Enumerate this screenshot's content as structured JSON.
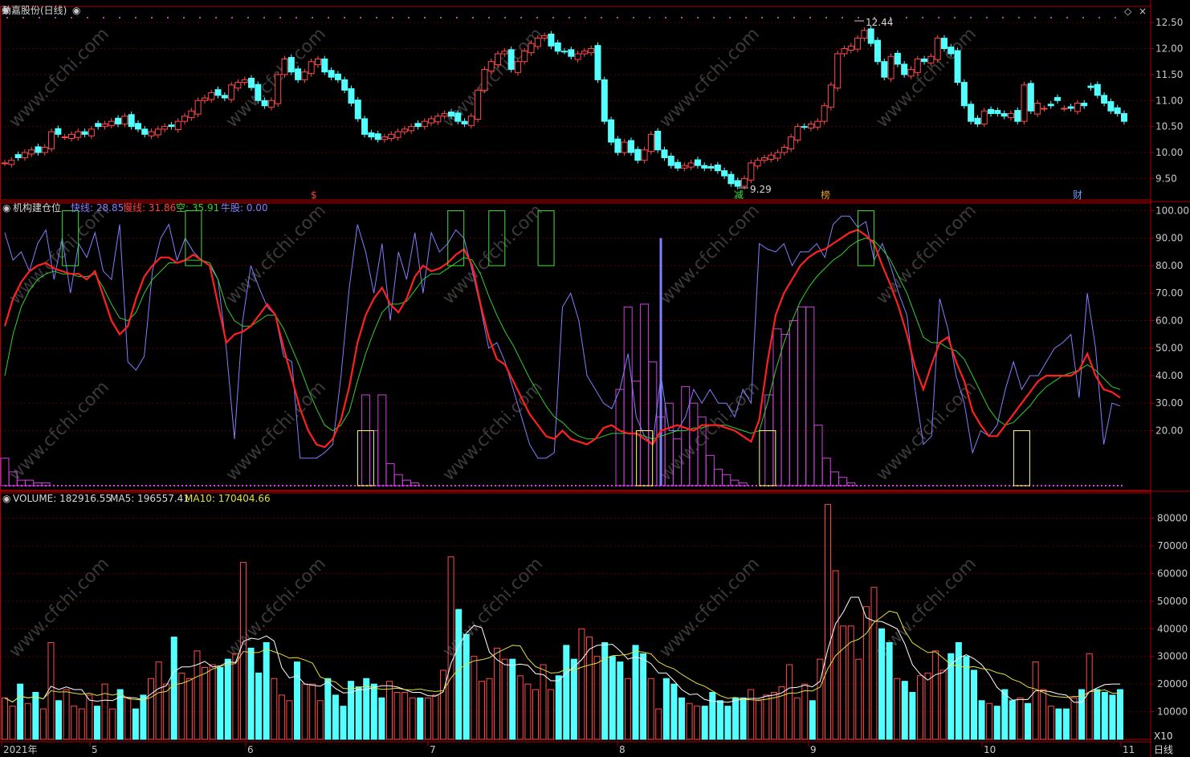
{
  "header": {
    "title": "劲嘉股份(日线)",
    "indicator_name": "机构建仓位",
    "fast_label": "快线: 28.85",
    "slow_label": "慢线: 31.86",
    "empty_label": "空: 35.91",
    "bull_label": "牛股: 0.00",
    "volume_label": "VOLUME: 182916.55",
    "ma5_label": "MA5: 196557.41",
    "ma10_label": "MA10: 170404.66",
    "x10_label": "X10",
    "period_label": "日线",
    "watermark": "www.cfchi.com"
  },
  "colors": {
    "up": "#ff4a4a",
    "down": "#54ffff",
    "axis": "#b00000",
    "grid": "#5a0000",
    "fast": "#8080ff",
    "slow": "#ff2020",
    "mid": "#30d030",
    "bar": "#d040e0",
    "box_green": "#40e040",
    "box_yellow": "#ffff60",
    "text": "#c8c8c8",
    "ma10": "#e0e040"
  },
  "markers": [
    {
      "text": "$",
      "color": "#ff4040"
    },
    {
      "text": "减",
      "color": "#40e040"
    },
    {
      "text": "榜",
      "color": "#e0a020"
    },
    {
      "text": "财",
      "color": "#60a0ff"
    }
  ],
  "chart_data": [
    {
      "type": "candlestick",
      "title": "劲嘉股份(日线)",
      "y_ticks": [
        9.5,
        10.0,
        10.5,
        11.0,
        11.5,
        12.0,
        12.5
      ],
      "ylim": [
        9.15,
        12.75
      ],
      "annotations": [
        {
          "text": "12.44",
          "value": 12.44
        },
        {
          "text": "9.29",
          "value": 9.29
        }
      ],
      "x_ticks": [
        "2021年",
        "5",
        "6",
        "7",
        "8",
        "9",
        "10",
        "11"
      ],
      "close": [
        9.8,
        9.85,
        9.9,
        10.0,
        10.05,
        10.0,
        10.1,
        10.4,
        10.35,
        10.3,
        10.35,
        10.4,
        10.35,
        10.45,
        10.5,
        10.55,
        10.6,
        10.55,
        10.7,
        10.5,
        10.45,
        10.35,
        10.4,
        10.45,
        10.5,
        10.5,
        10.6,
        10.7,
        10.8,
        11.0,
        11.05,
        11.15,
        11.1,
        11.05,
        11.3,
        11.35,
        11.4,
        11.25,
        11.0,
        10.9,
        11.0,
        11.5,
        11.8,
        11.55,
        11.4,
        11.55,
        11.75,
        11.8,
        11.55,
        11.45,
        11.4,
        11.2,
        10.95,
        10.65,
        10.35,
        10.3,
        10.25,
        10.3,
        10.35,
        10.4,
        10.45,
        10.5,
        10.5,
        10.6,
        10.65,
        10.7,
        10.75,
        10.7,
        10.6,
        10.55,
        10.7,
        11.2,
        11.6,
        11.75,
        11.9,
        11.95,
        11.6,
        11.75,
        11.95,
        12.1,
        12.2,
        12.25,
        12.05,
        11.95,
        11.95,
        11.85,
        11.9,
        11.95,
        12.0,
        11.4,
        10.6,
        10.2,
        10.0,
        10.2,
        10.0,
        9.85,
        10.05,
        10.35,
        10.05,
        9.9,
        9.75,
        9.7,
        9.75,
        9.8,
        9.75,
        9.7,
        9.7,
        9.65,
        9.55,
        9.4,
        9.35,
        9.5,
        9.8,
        9.85,
        9.9,
        9.95,
        10.0,
        10.1,
        10.3,
        10.5,
        10.5,
        10.55,
        10.6,
        10.9,
        11.3,
        11.9,
        12.0,
        12.05,
        12.2,
        12.35,
        12.1,
        11.75,
        11.45,
        11.85,
        11.7,
        11.5,
        11.6,
        11.8,
        11.75,
        11.85,
        12.2,
        12.0,
        11.9,
        11.35,
        10.9,
        10.6,
        10.55,
        10.8,
        10.75,
        10.75,
        10.7,
        10.75,
        10.6,
        11.3,
        10.8,
        10.95,
        10.85,
        10.9,
        11.0,
        10.85,
        10.85,
        10.95,
        10.9,
        11.25,
        11.1,
        10.95,
        10.8,
        10.75,
        10.6
      ],
      "up": [
        true,
        true,
        false,
        true,
        true,
        false,
        true,
        true,
        false,
        true,
        true,
        true,
        false,
        true,
        false,
        true,
        true,
        false,
        true,
        false,
        false,
        false,
        true,
        true,
        true,
        false,
        true,
        true,
        true,
        true,
        true,
        true,
        false,
        false,
        true,
        true,
        true,
        false,
        false,
        false,
        true,
        true,
        true,
        false,
        false,
        true,
        true,
        true,
        false,
        false,
        false,
        false,
        false,
        false,
        false,
        false,
        false,
        true,
        true,
        true,
        true,
        true,
        false,
        true,
        true,
        true,
        true,
        false,
        false,
        false,
        true,
        true,
        true,
        true,
        true,
        true,
        false,
        true,
        true,
        true,
        true,
        true,
        false,
        false,
        false,
        false,
        true,
        true,
        true,
        false,
        false,
        false,
        false,
        true,
        false,
        false,
        true,
        true,
        false,
        false,
        false,
        false,
        true,
        true,
        false,
        false,
        false,
        false,
        false,
        false,
        false,
        true,
        true,
        true,
        true,
        true,
        true,
        true,
        true,
        true,
        false,
        true,
        true,
        true,
        true,
        true,
        true,
        true,
        true,
        true,
        false,
        false,
        false,
        true,
        false,
        false,
        true,
        true,
        false,
        true,
        true,
        false,
        false,
        false,
        false,
        false,
        false,
        true,
        false,
        false,
        false,
        true,
        false,
        true,
        false,
        true,
        true,
        false,
        false,
        true,
        false,
        true,
        false,
        false,
        false,
        false,
        false
      ]
    },
    {
      "type": "line",
      "title": "机构建仓位",
      "y_ticks": [
        20,
        30,
        40,
        50,
        60,
        70,
        80,
        90,
        100
      ],
      "ylim": [
        0,
        101
      ],
      "series": [
        {
          "name": "快线",
          "values": [
            92,
            82,
            85,
            78,
            88,
            93,
            75,
            90,
            70,
            88,
            83,
            92,
            78,
            75,
            95,
            45,
            42,
            47,
            78,
            90,
            95,
            82,
            90,
            85,
            82,
            80,
            75,
            50,
            17,
            60,
            80,
            72,
            65,
            62,
            47,
            45,
            10,
            10,
            10,
            12,
            15,
            40,
            72,
            95,
            85,
            70,
            88,
            60,
            85,
            75,
            92,
            70,
            92,
            85,
            88,
            93,
            90,
            78,
            65,
            50,
            52,
            45,
            35,
            25,
            15,
            10,
            10,
            12,
            65,
            70,
            60,
            40,
            35,
            30,
            28,
            35,
            48,
            25,
            18,
            15,
            40,
            20,
            20,
            25,
            35,
            30,
            35,
            30,
            30,
            25,
            35,
            30,
            88,
            86,
            85,
            88,
            80,
            85,
            85,
            88,
            83,
            95,
            98,
            98,
            94,
            96,
            82,
            88,
            80,
            70,
            62,
            35,
            15,
            18,
            68,
            57,
            40,
            30,
            12,
            20,
            18,
            22,
            35,
            45,
            35,
            40,
            40,
            45,
            50,
            52,
            55,
            32,
            70,
            50,
            15,
            30,
            29
          ]
        },
        {
          "name": "慢线",
          "values": [
            58,
            68,
            74,
            78,
            80,
            81,
            79,
            78,
            77,
            77,
            75,
            78,
            69,
            60,
            55,
            58,
            68,
            76,
            80,
            83,
            83,
            81,
            82,
            84,
            82,
            80,
            66,
            52,
            55,
            56,
            58,
            62,
            66,
            62,
            50,
            39,
            28,
            20,
            15,
            14,
            17,
            24,
            36,
            52,
            62,
            68,
            72,
            66,
            63,
            68,
            76,
            80,
            78,
            79,
            81,
            84,
            86,
            80,
            66,
            54,
            46,
            44,
            38,
            32,
            26,
            22,
            18,
            17,
            20,
            17,
            16,
            15,
            17,
            21,
            22,
            20,
            19,
            19,
            17,
            15,
            20,
            21,
            22,
            21,
            20,
            22,
            22,
            22,
            21,
            20,
            18,
            16,
            24,
            45,
            62,
            70,
            75,
            80,
            83,
            85,
            86,
            88,
            90,
            92,
            93,
            91,
            88,
            80,
            73,
            65,
            55,
            43,
            35,
            44,
            52,
            54,
            45,
            38,
            27,
            22,
            18,
            18,
            22,
            26,
            30,
            34,
            38,
            40,
            40,
            40,
            40,
            42,
            48,
            40,
            35,
            34,
            32
          ]
        },
        {
          "name": "空",
          "values": [
            40,
            55,
            65,
            71,
            75,
            77,
            78,
            77,
            77,
            76,
            76,
            77,
            72,
            66,
            61,
            60,
            63,
            70,
            75,
            78,
            81,
            81,
            82,
            82,
            82,
            81,
            75,
            65,
            60,
            58,
            58,
            60,
            62,
            62,
            57,
            50,
            43,
            35,
            28,
            22,
            20,
            22,
            27,
            38,
            48,
            56,
            63,
            66,
            66,
            67,
            71,
            75,
            77,
            77,
            79,
            81,
            83,
            82,
            77,
            69,
            62,
            56,
            51,
            45,
            39,
            34,
            29,
            25,
            23,
            20,
            18,
            17,
            17,
            18,
            19,
            19,
            19,
            19,
            18,
            17,
            18,
            19,
            20,
            20,
            21,
            21,
            22,
            22,
            22,
            21,
            20,
            19,
            20,
            30,
            42,
            52,
            60,
            67,
            72,
            76,
            79,
            82,
            84,
            87,
            89,
            90,
            89,
            86,
            82,
            76,
            70,
            62,
            54,
            52,
            52,
            50,
            49,
            46,
            40,
            34,
            28,
            24,
            22,
            23,
            26,
            29,
            33,
            36,
            38,
            40,
            41,
            42,
            44,
            42,
            39,
            36,
            35
          ]
        },
        {
          "name": "牛股",
          "values": [
            0
          ]
        }
      ],
      "signal_bars": [
        10,
        5,
        2,
        2,
        1,
        1,
        0,
        0,
        0,
        0,
        0,
        0,
        0,
        0,
        0,
        0,
        0,
        0,
        0,
        0,
        0,
        0,
        0,
        0,
        0,
        0,
        0,
        0,
        0,
        0,
        0,
        0,
        0,
        0,
        0,
        0,
        0,
        0,
        0,
        0,
        0,
        0,
        0,
        0,
        33,
        20,
        33,
        8,
        4,
        2,
        1,
        0,
        0,
        0,
        0,
        0,
        0,
        0,
        0,
        0,
        0,
        0,
        0,
        0,
        0,
        0,
        0,
        0,
        0,
        0,
        0,
        0,
        0,
        0,
        0,
        0,
        0,
        0,
        0,
        0,
        0,
        0,
        0,
        0,
        0,
        0,
        0,
        0,
        0,
        0,
        0,
        0,
        0,
        0,
        0,
        0,
        0,
        0,
        0,
        0,
        0,
        0,
        0,
        0,
        0,
        0,
        0,
        0,
        0,
        0,
        0,
        0,
        0,
        0,
        0,
        0,
        0,
        0,
        0,
        0,
        0,
        0,
        0,
        0,
        0,
        0,
        0,
        0,
        0,
        0,
        0,
        0,
        0,
        0,
        0,
        0,
        0,
        0
      ],
      "spike": 90,
      "green_boxes": [
        8,
        23,
        55,
        60,
        66,
        105
      ],
      "yellow_boxes": [
        44,
        78,
        93,
        124
      ]
    },
    {
      "type": "bar",
      "title": "VOLUME",
      "y_ticks": [
        10000,
        20000,
        30000,
        40000,
        50000,
        60000,
        70000,
        80000
      ],
      "ylim": [
        0,
        88000
      ],
      "series": [
        {
          "name": "VOLUME",
          "values": [
            15000,
            12000,
            20000,
            13000,
            17000,
            11000,
            35000,
            14000,
            18000,
            12000,
            11000,
            16000,
            12000,
            20000,
            11000,
            18000,
            15000,
            11000,
            16000,
            22000,
            28000,
            20000,
            37000,
            24000,
            22000,
            32000,
            26000,
            27000,
            26000,
            29000,
            31000,
            64000,
            33000,
            24000,
            35000,
            22000,
            16000,
            14000,
            28000,
            20000,
            20000,
            14000,
            22000,
            16000,
            12000,
            21000,
            19000,
            22000,
            20000,
            15000,
            21000,
            17000,
            17000,
            15000,
            15000,
            15000,
            16000,
            25000,
            66000,
            47000,
            38000,
            30000,
            21000,
            22000,
            33000,
            29000,
            29000,
            23000,
            20000,
            18000,
            27000,
            18000,
            23000,
            34000,
            29000,
            40000,
            37000,
            30000,
            35000,
            30000,
            28000,
            22000,
            34000,
            31000,
            22000,
            11000,
            22000,
            20000,
            15000,
            13000,
            12000,
            12000,
            17000,
            14000,
            12000,
            15000,
            15000,
            18000,
            14000,
            16000,
            17000,
            19000,
            27000,
            15000,
            20000,
            14000,
            29000,
            85000,
            61000,
            41000,
            41000,
            29000,
            48000,
            55000,
            40000,
            35000,
            22000,
            21000,
            17000,
            23000,
            24000,
            32000,
            25000,
            31000,
            35000,
            30000,
            25000,
            14000,
            13000,
            12000,
            18000,
            14000,
            15000,
            13000,
            28000,
            18000,
            12000,
            11000,
            11000,
            15000,
            18000,
            31000,
            18000,
            17000,
            16000,
            18000
          ],
          "up": true
        }
      ]
    }
  ]
}
